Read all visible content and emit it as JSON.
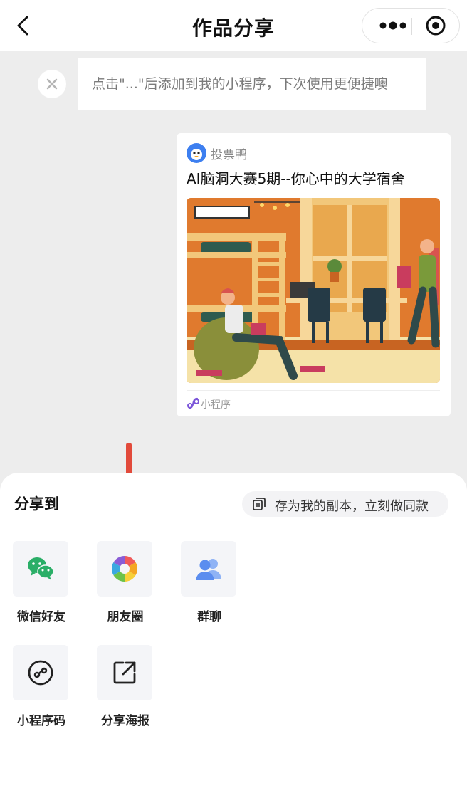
{
  "nav": {
    "title": "作品分享",
    "back_icon": "chevron-left-icon",
    "more_icon": "more-dots-icon",
    "close_icon": "target-circle-icon"
  },
  "tip": {
    "text": "点击\"...\"后添加到我的小程序，下次使用更便捷噢",
    "close_icon": "close-icon"
  },
  "card": {
    "app_name": "投票鸭",
    "title": "AI脑洞大赛5期--你心中的大学宿舍",
    "footer_label": "小程序",
    "image_icon": "dorm-illustration"
  },
  "sheet": {
    "title": "分享到",
    "copy_label": "存为我的副本，立刻做同款",
    "options": [
      {
        "label": "微信好友",
        "icon": "wechat-icon"
      },
      {
        "label": "朋友圈",
        "icon": "moments-icon"
      },
      {
        "label": "群聊",
        "icon": "group-chat-icon"
      },
      {
        "label": "小程序码",
        "icon": "miniprogram-code-icon"
      },
      {
        "label": "分享海报",
        "icon": "share-poster-icon"
      }
    ]
  },
  "colors": {
    "accent_arrow": "#e24a3b",
    "wechat_green": "#2aae67",
    "group_blue": "#5b8def",
    "mp_purple": "#7b55d9"
  }
}
